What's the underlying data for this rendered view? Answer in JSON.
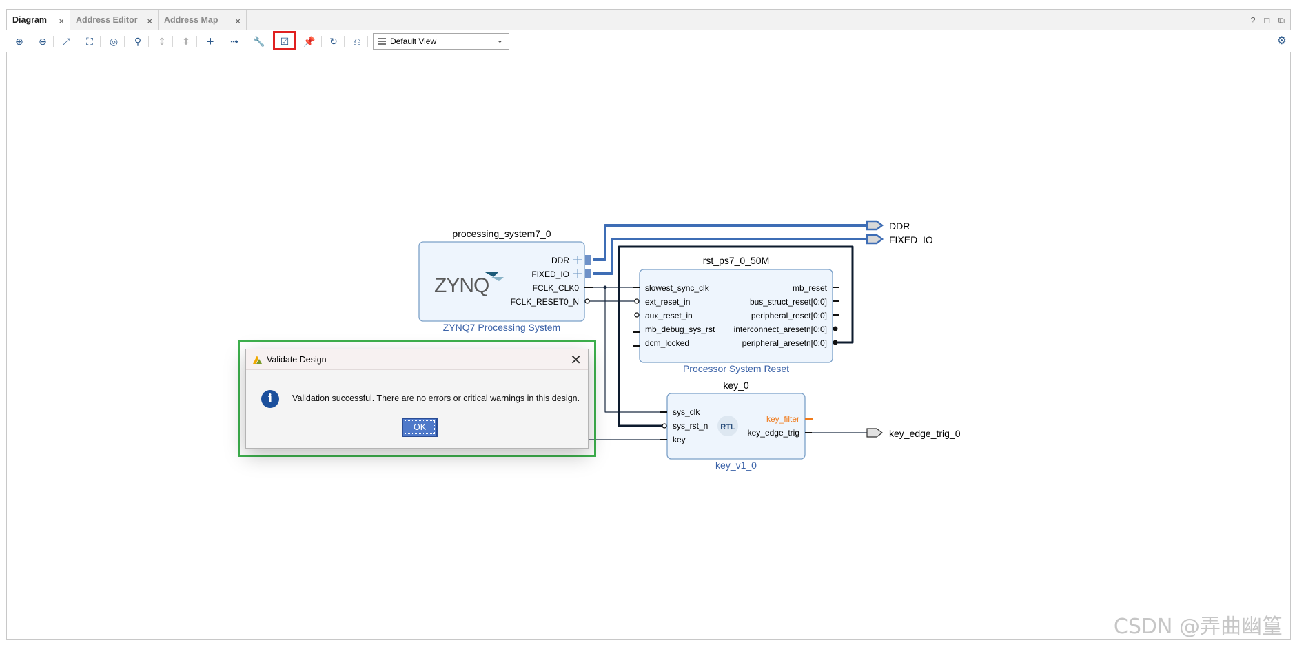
{
  "tabs": [
    {
      "label": "Diagram",
      "active": true
    },
    {
      "label": "Address Editor",
      "active": false
    },
    {
      "label": "Address Map",
      "active": false
    }
  ],
  "tab_close_glyph": "×",
  "window_controls": {
    "help": "?",
    "restore": "□",
    "popout": "⧉"
  },
  "toolbar": {
    "view_select": "Default View",
    "icons": [
      "zoom-in-icon",
      "zoom-out-icon",
      "fit-icon",
      "fit-selection-icon",
      "auto-fit-icon",
      "search-icon",
      "collapse-icon",
      "expand-icon",
      "add-ip-icon",
      "make-connection-icon",
      "settings-wrench-icon",
      "validate-design-icon",
      "pin-icon",
      "regenerate-layout-icon",
      "optimize-routing-icon"
    ],
    "gear": "⚙"
  },
  "diagram": {
    "ps": {
      "instance": "processing_system7_0",
      "type": "ZYNQ7 Processing System",
      "logo": "ZYNQ",
      "ports": [
        "DDR",
        "FIXED_IO",
        "FCLK_CLK0",
        "FCLK_RESET0_N"
      ]
    },
    "rst": {
      "instance": "rst_ps7_0_50M",
      "type": "Processor System Reset",
      "in_ports": [
        "slowest_sync_clk",
        "ext_reset_in",
        "aux_reset_in",
        "mb_debug_sys_rst",
        "dcm_locked"
      ],
      "out_ports": [
        "mb_reset",
        "bus_struct_reset[0:0]",
        "peripheral_reset[0:0]",
        "interconnect_aresetn[0:0]",
        "peripheral_aresetn[0:0]"
      ]
    },
    "key": {
      "instance": "key_0",
      "type": "key_v1_0",
      "badge": "RTL",
      "in_ports": [
        "sys_clk",
        "sys_rst_n",
        "key"
      ],
      "out_ports": [
        "key_filter",
        "key_edge_trig"
      ]
    },
    "external_ports": [
      "DDR",
      "FIXED_IO",
      "key_edge_trig_0"
    ],
    "colors": {
      "bus": "#3e6db5",
      "wire": "#0d1b2e",
      "block_fill": "#eef5fd",
      "block_border": "#7ba0c8",
      "type_label": "#3c63a8",
      "key_filter": "#f07a1a"
    }
  },
  "dialog": {
    "title": "Validate Design",
    "message": "Validation successful. There are no errors or critical warnings in this design.",
    "ok_label": "OK",
    "close_glyph": "✕",
    "info_glyph": "i"
  },
  "watermark": "CSDN @弄曲幽篁"
}
